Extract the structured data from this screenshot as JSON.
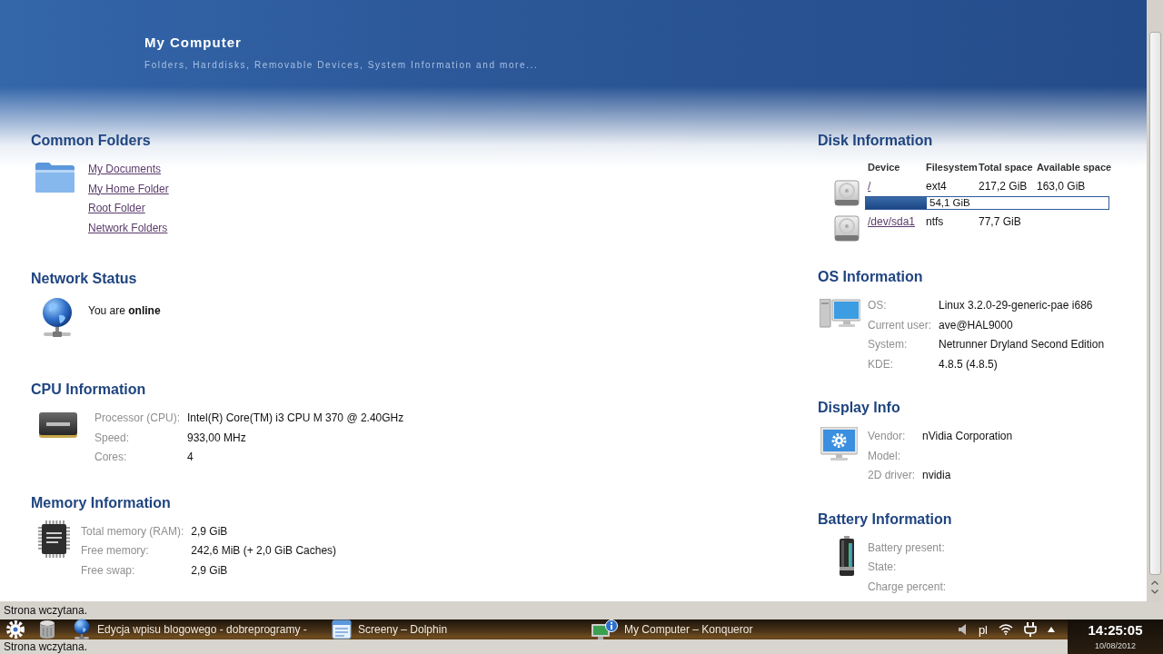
{
  "header": {
    "title": "My Computer",
    "subtitle": "Folders, Harddisks, Removable Devices, System Information and more..."
  },
  "left_column": [
    {
      "kind": "links",
      "title": "Common Folders",
      "links": [
        "My Documents",
        "My Home Folder",
        "Root Folder",
        "Network Folders"
      ]
    },
    {
      "kind": "text",
      "title": "Network Status",
      "text": "You are **online**"
    },
    {
      "kind": "properties",
      "title": "CPU Information",
      "rows": [
        {
          "label": "Processor (CPU):",
          "value": "Intel(R) Core(TM) i3 CPU M 370 @ 2.40GHz"
        },
        {
          "label": "Speed:",
          "value": "933,00 MHz"
        },
        {
          "label": "Cores:",
          "value": "4"
        }
      ]
    },
    {
      "kind": "properties",
      "title": "Memory Information",
      "rows": [
        {
          "label": "Total memory (RAM):",
          "value": "2,9 GiB"
        },
        {
          "label": "Free memory:",
          "value": "242,6 MiB (+ 2,0 GiB Caches)"
        },
        {
          "label": "Free swap:",
          "value": "2,9 GiB"
        }
      ]
    }
  ],
  "right_column": [
    {
      "kind": "disks",
      "title": "Disk Information",
      "columns": [
        "Device",
        "Filesystem",
        "Total space",
        "Available space"
      ],
      "disks": [
        {
          "device": "/",
          "filesystem": "ext4",
          "total": "217,2 GiB",
          "available": "163,0 GiB",
          "usage": {
            "level": 0.25,
            "reading": "54,1 GiB"
          }
        },
        {
          "device": "/dev/sda1",
          "filesystem": "ntfs",
          "total": "77,7 GiB"
        }
      ]
    },
    {
      "kind": "properties",
      "title": "OS Information",
      "rows": [
        {
          "label": "OS:",
          "value": "Linux 3.2.0-29-generic-pae i686"
        },
        {
          "label": "Current user:",
          "value": "ave@HAL9000"
        },
        {
          "label": "System:",
          "value": "Netrunner Dryland Second Edition"
        },
        {
          "label": "KDE:",
          "value": "4.8.5 (4.8.5)"
        }
      ]
    },
    {
      "kind": "properties",
      "title": "Display Info",
      "rows": [
        {
          "label": "Vendor:",
          "value": "nVidia Corporation"
        },
        {
          "label": "Model:"
        },
        {
          "label": "2D driver:",
          "value": "nvidia"
        }
      ]
    },
    {
      "kind": "properties",
      "title": "Battery Information",
      "rows": [
        {
          "label": "Battery present:"
        },
        {
          "label": "State:"
        },
        {
          "label": "Charge percent:"
        }
      ]
    }
  ],
  "status_bar": {
    "text": "Strona wczytana."
  },
  "taskbar": {
    "tasks": [
      {
        "label": "Edycja wpisu blogowego - dobreprogramy -"
      },
      {
        "label": "Screeny – Dolphin"
      },
      {
        "label": "My Computer – Konqueror"
      }
    ],
    "keyboard_layout": "pl",
    "overlay_text": "Strona wczytana.",
    "clock": {
      "time": "14:25:05",
      "date": "10/08/2012"
    }
  }
}
